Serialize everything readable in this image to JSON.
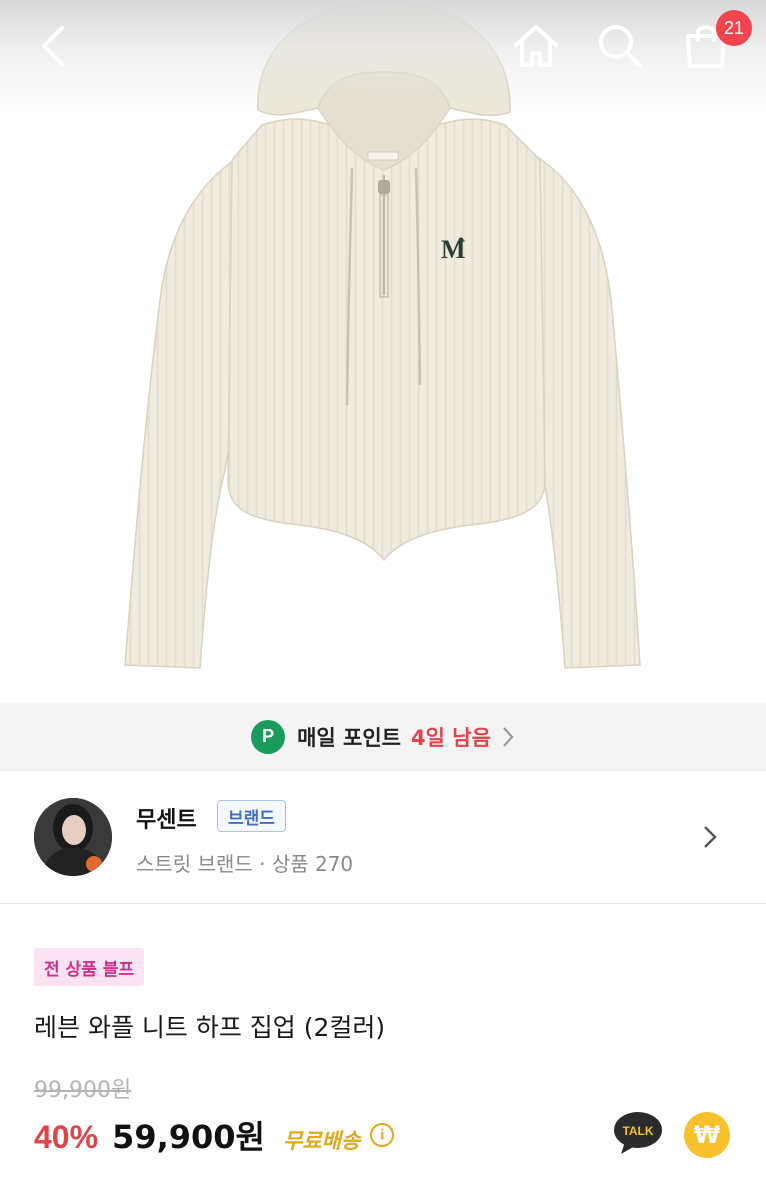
{
  "header": {
    "icons": [
      "back-chevron-icon",
      "home-icon",
      "search-icon",
      "shopping-bag-icon"
    ],
    "cart_count": "21"
  },
  "product_image": {
    "logo_letter": "M"
  },
  "points_banner": {
    "icon_letter": "P",
    "text": "매일 포인트",
    "highlight": "4일 남음",
    "highlight_color": "#e0444b"
  },
  "brand": {
    "name": "무센트",
    "tag": "브랜드",
    "subtitle": "스트릿 브랜드 · 상품 270"
  },
  "product": {
    "promo_badge": "전 상품 블프",
    "title": "레븐 와플 니트 하프 집업 (2컬러)",
    "original_price": "99,900원",
    "discount": "40%",
    "price": "59,900원",
    "shipping": "무료배송",
    "talk_label": "TALK",
    "won_symbol": "₩"
  },
  "colors": {
    "accent_red": "#e0444b",
    "badge_red": "#f0444e",
    "points_green": "#1a9b5b",
    "shipping_gold": "#e0a81a",
    "promo_pink": "#cf2f8c"
  }
}
